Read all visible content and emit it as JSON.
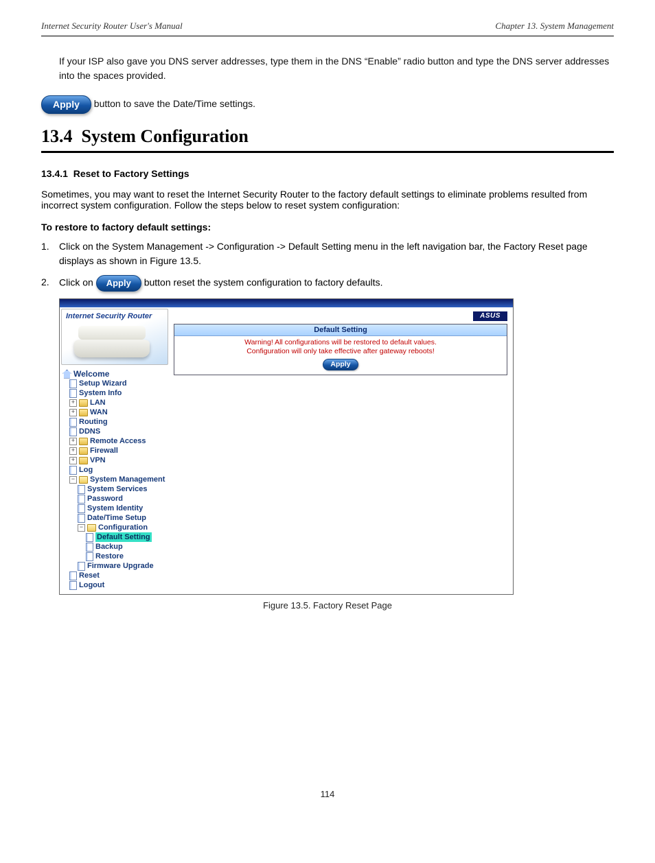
{
  "header": {
    "left": "Internet Security Router User's Manual",
    "right": "Chapter 13. System Management"
  },
  "intro_para": "If your ISP also gave you DNS server addresses, type them in the DNS “Enable” radio button and type the DNS server addresses into the spaces provided.",
  "apply_btn": "Apply",
  "save_note": " button to save the Date/Time settings.",
  "s134": {
    "num": "13.4",
    "title": "System Configuration",
    "sub_num": "13.4.1",
    "sub_title": "Reset to Factory Settings",
    "lead": "Sometimes, you may want to reset the Internet Security Router to the factory default settings to eliminate problems resulted from incorrect system configuration. Follow the steps below to reset system configuration:",
    "steps_title": "To restore to factory default settings:",
    "step1_num": "1.",
    "step1_txt": "Click on the System Management  -> Configuration  -> Default Setting  menu in the left navigation bar, the Factory Reset page displays as shown in Figure 13.5.",
    "step2_num": "2.",
    "step2_txt_pre": "Click on ",
    "step2_txt_post": " button reset the system configuration to factory defaults."
  },
  "figcap": "Figure 13.5. Factory Reset Page",
  "pagenum": "114",
  "shot": {
    "brand_title": "Internet Security Router",
    "logo": "ASUS",
    "panel_title": "Default Setting",
    "warn1": "Warning! All configurations will be restored to default values.",
    "warn2": "Configuration will only take effective after gateway reboots!",
    "panel_btn": "Apply",
    "tree": {
      "welcome": "Welcome",
      "items": [
        {
          "key": "setup",
          "label": "Setup Wizard",
          "indent": 1,
          "icon": "page"
        },
        {
          "key": "sysinfo",
          "label": "System Info",
          "indent": 1,
          "icon": "page"
        },
        {
          "key": "lan",
          "label": "LAN",
          "indent": 1,
          "icon": "fc",
          "pm": "+"
        },
        {
          "key": "wan",
          "label": "WAN",
          "indent": 1,
          "icon": "fc",
          "pm": "+"
        },
        {
          "key": "routing",
          "label": "Routing",
          "indent": 1,
          "icon": "page"
        },
        {
          "key": "ddns",
          "label": "DDNS",
          "indent": 1,
          "icon": "page"
        },
        {
          "key": "remote",
          "label": "Remote Access",
          "indent": 1,
          "icon": "fc",
          "pm": "+"
        },
        {
          "key": "firewall",
          "label": "Firewall",
          "indent": 1,
          "icon": "fc",
          "pm": "+"
        },
        {
          "key": "vpn",
          "label": "VPN",
          "indent": 1,
          "icon": "fc",
          "pm": "+"
        },
        {
          "key": "log",
          "label": "Log",
          "indent": 1,
          "icon": "page"
        },
        {
          "key": "sysmgmt",
          "label": "System Management",
          "indent": 1,
          "icon": "fo",
          "pm": "−"
        },
        {
          "key": "syssvc",
          "label": "System Services",
          "indent": 2,
          "icon": "page"
        },
        {
          "key": "pwd",
          "label": "Password",
          "indent": 2,
          "icon": "page"
        },
        {
          "key": "ident",
          "label": "System Identity",
          "indent": 2,
          "icon": "page"
        },
        {
          "key": "dts",
          "label": "Date/Time Setup",
          "indent": 2,
          "icon": "page"
        },
        {
          "key": "config",
          "label": "Configuration",
          "indent": 2,
          "icon": "fo",
          "pm": "−"
        },
        {
          "key": "defset",
          "label": "Default Setting",
          "indent": 3,
          "icon": "page",
          "selected": true
        },
        {
          "key": "backup",
          "label": "Backup",
          "indent": 3,
          "icon": "page"
        },
        {
          "key": "restore",
          "label": "Restore",
          "indent": 3,
          "icon": "page"
        },
        {
          "key": "fw",
          "label": "Firmware Upgrade",
          "indent": 2,
          "icon": "page"
        },
        {
          "key": "reset",
          "label": "Reset",
          "indent": 1,
          "icon": "page"
        },
        {
          "key": "logout",
          "label": "Logout",
          "indent": 1,
          "icon": "page"
        }
      ]
    }
  }
}
